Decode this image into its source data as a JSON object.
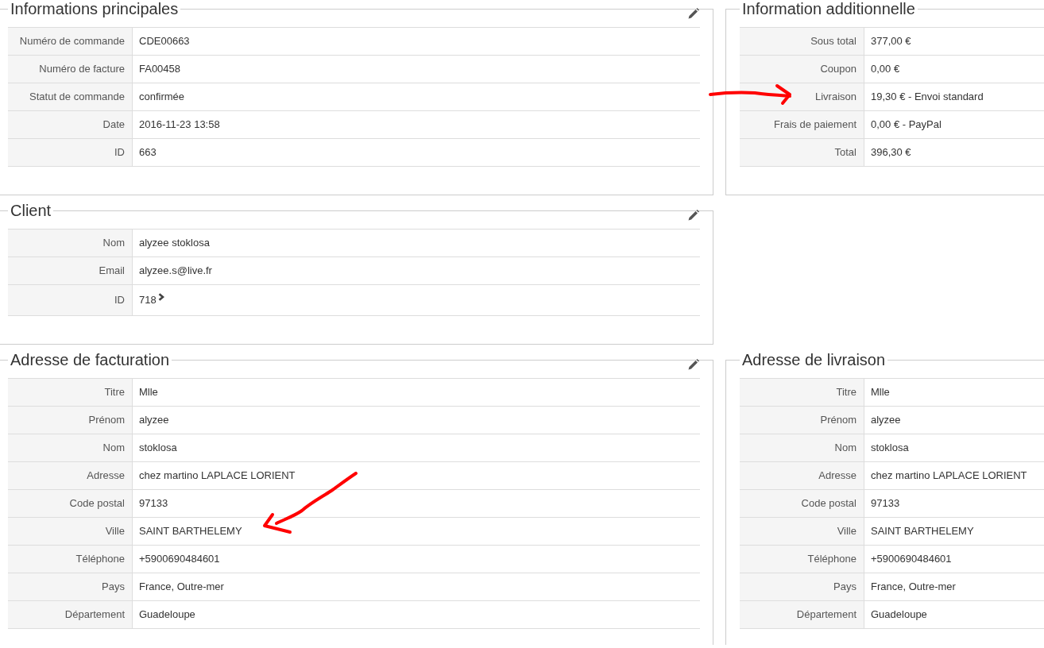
{
  "panel_rows": [
    {
      "panels": [
        {
          "title": "Informations principales",
          "editable": true,
          "rows": [
            {
              "label": "Numéro de commande",
              "value": "CDE00663"
            },
            {
              "label": "Numéro de facture",
              "value": "FA00458"
            },
            {
              "label": "Statut de commande",
              "value": "confirmée"
            },
            {
              "label": "Date",
              "value": "2016-11-23 13:58"
            },
            {
              "label": "ID",
              "value": "663"
            }
          ]
        },
        {
          "title": "Information additionnelle",
          "editable": false,
          "rows": [
            {
              "label": "Sous total",
              "value": "377,00 €"
            },
            {
              "label": "Coupon",
              "value": "0,00 €"
            },
            {
              "label": "Livraison",
              "value": "19,30 € - Envoi standard"
            },
            {
              "label": "Frais de paiement",
              "value": "0,00 € - PayPal"
            },
            {
              "label": "Total",
              "value": "396,30 €"
            }
          ]
        }
      ]
    },
    {
      "panels": [
        {
          "title": "Client",
          "editable": true,
          "rows": [
            {
              "label": "Nom",
              "value": "alyzee stoklosa",
              "link": false
            },
            {
              "label": "Email",
              "value": "alyzee.s@live.fr",
              "link": false
            },
            {
              "label": "ID",
              "value": "718",
              "link": true
            }
          ]
        }
      ]
    },
    {
      "panels": [
        {
          "title": "Adresse de facturation",
          "editable": true,
          "rows": [
            {
              "label": "Titre",
              "value": "Mlle"
            },
            {
              "label": "Prénom",
              "value": "alyzee"
            },
            {
              "label": "Nom",
              "value": "stoklosa"
            },
            {
              "label": "Adresse",
              "value": "chez martino LAPLACE LORIENT"
            },
            {
              "label": "Code postal",
              "value": "97133"
            },
            {
              "label": "Ville",
              "value": "SAINT BARTHELEMY"
            },
            {
              "label": "Téléphone",
              "value": "+5900690484601"
            },
            {
              "label": "Pays",
              "value": "France, Outre-mer"
            },
            {
              "label": "Département",
              "value": "Guadeloupe"
            }
          ]
        },
        {
          "title": "Adresse de livraison",
          "editable": false,
          "rows": [
            {
              "label": "Titre",
              "value": "Mlle"
            },
            {
              "label": "Prénom",
              "value": "alyzee"
            },
            {
              "label": "Nom",
              "value": "stoklosa"
            },
            {
              "label": "Adresse",
              "value": "chez martino LAPLACE LORIENT"
            },
            {
              "label": "Code postal",
              "value": "97133"
            },
            {
              "label": "Ville",
              "value": "SAINT BARTHELEMY"
            },
            {
              "label": "Téléphone",
              "value": "+5900690484601"
            },
            {
              "label": "Pays",
              "value": "France, Outre-mer"
            },
            {
              "label": "Département",
              "value": "Guadeloupe"
            }
          ]
        }
      ]
    }
  ]
}
